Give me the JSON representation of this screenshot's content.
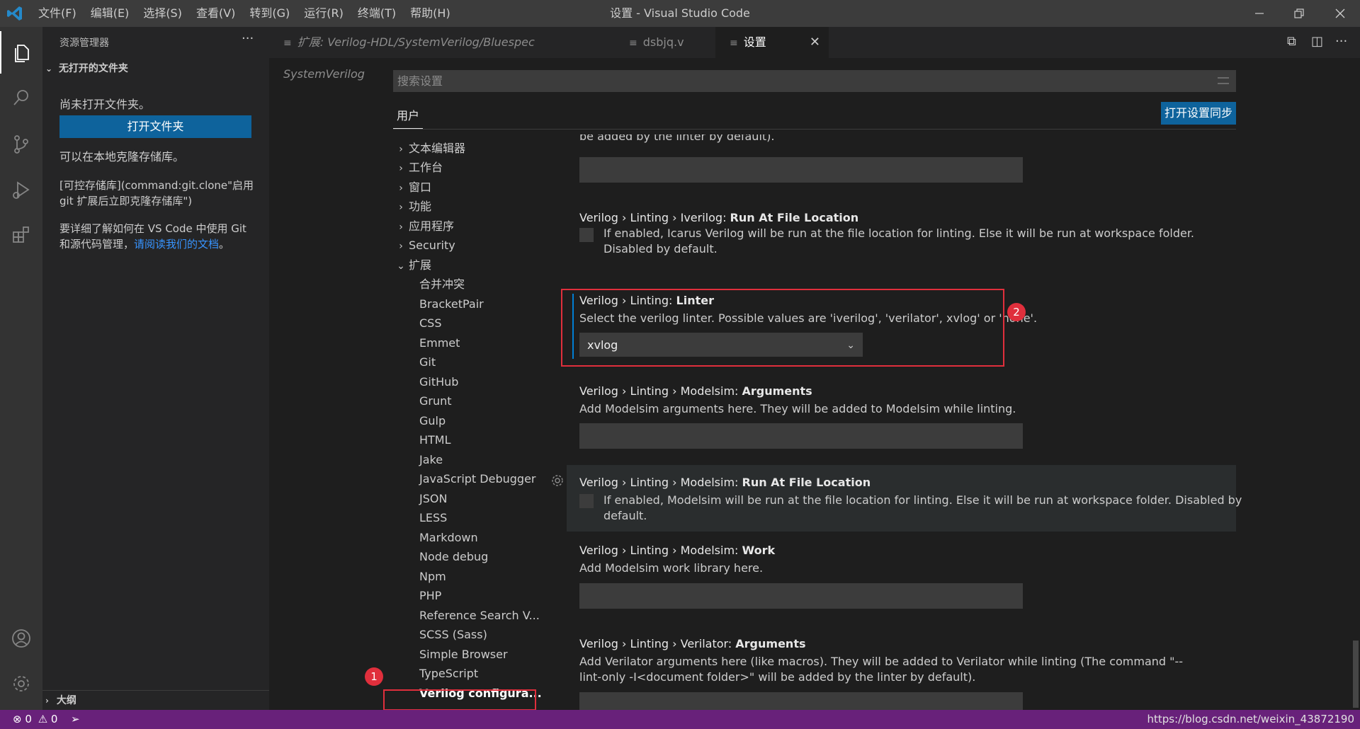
{
  "titlebar": {
    "menu": [
      "文件(F)",
      "编辑(E)",
      "选择(S)",
      "查看(V)",
      "转到(G)",
      "运行(R)",
      "终端(T)",
      "帮助(H)"
    ],
    "title": "设置 - Visual Studio Code"
  },
  "sidebar": {
    "header": "资源管理器",
    "more": "···",
    "section": "无打开的文件夹",
    "no_folder_text": "尚未打开文件夹。",
    "open_folder_button": "打开文件夹",
    "clone_text": "可以在本地克隆存储库。",
    "clone_link_text": "[可控存储库](command:git.clone\"启用 git 扩展后立即克隆存储库\")",
    "learn_text": "要详细了解如何在 VS Code 中使用 Git 和源代码管理，",
    "learn_link": "请阅读我们的文档",
    "learn_end": "。",
    "outline": "大纲"
  },
  "tabs": [
    {
      "label": "扩展: Verilog-HDL/SystemVerilog/Bluespec SystemVerilog",
      "italic": true
    },
    {
      "label": "dsbjq.v"
    },
    {
      "label": "设置",
      "active": true
    }
  ],
  "settings": {
    "search_placeholder": "搜索设置",
    "user_tab": "用户",
    "sync_button": "打开设置同步",
    "toc": [
      {
        "label": "文本编辑器",
        "expanded": false
      },
      {
        "label": "工作台",
        "expanded": false
      },
      {
        "label": "窗口",
        "expanded": false
      },
      {
        "label": "功能",
        "expanded": false
      },
      {
        "label": "应用程序",
        "expanded": false
      },
      {
        "label": "Security",
        "expanded": false
      },
      {
        "label": "扩展",
        "expanded": true
      }
    ],
    "toc_ext": [
      "合并冲突",
      "BracketPair",
      "CSS",
      "Emmet",
      "Git",
      "GitHub",
      "Grunt",
      "Gulp",
      "HTML",
      "Jake",
      "JavaScript Debugger",
      "JSON",
      "LESS",
      "Markdown",
      "Node debug",
      "Npm",
      "PHP",
      "Reference Search V...",
      "SCSS (Sass)",
      "Simple Browser",
      "TypeScript",
      "Verilog configura..."
    ],
    "partial_top": "be added by the linter by default).",
    "items": [
      {
        "prefix": "Verilog › Linting › Iverilog: ",
        "name": "Run At File Location",
        "desc": "If enabled, Icarus Verilog will be run at the file location for linting. Else it will be run at workspace folder. Disabled by default."
      },
      {
        "prefix": "Verilog › Linting: ",
        "name": "Linter",
        "desc": "Select the verilog linter. Possible values are 'iverilog', 'verilator', xvlog' or 'none'.",
        "value": "xvlog"
      },
      {
        "prefix": "Verilog › Linting › Modelsim: ",
        "name": "Arguments",
        "desc": "Add Modelsim arguments here. They will be added to Modelsim while linting."
      },
      {
        "prefix": "Verilog › Linting › Modelsim: ",
        "name": "Run At File Location",
        "desc": "If enabled, Modelsim will be run at the file location for linting. Else it will be run at workspace folder. Disabled by default."
      },
      {
        "prefix": "Verilog › Linting › Modelsim: ",
        "name": "Work",
        "desc": "Add Modelsim work library here."
      },
      {
        "prefix": "Verilog › Linting › Verilator: ",
        "name": "Arguments",
        "desc": "Add Verilator arguments here (like macros). They will be added to Verilator while linting (The command \"--lint-only -I<document folder>\" will be added by the linter by default)."
      }
    ]
  },
  "annotations": [
    "1",
    "2"
  ],
  "status": {
    "errors": "0",
    "warnings": "0",
    "watermark": "https://blog.csdn.net/weixin_43872190"
  },
  "colors": {
    "accent": "#0e639c",
    "status_bar": "#68217a",
    "annotation": "#e02f3c"
  }
}
